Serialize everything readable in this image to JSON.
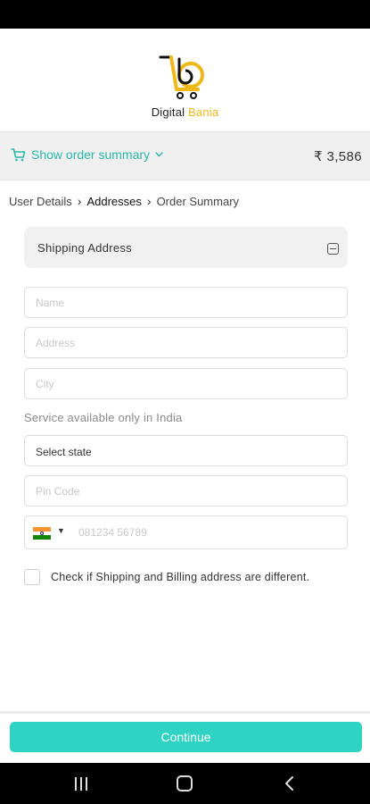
{
  "brand": {
    "logo_word1": "Digital",
    "logo_word2": "Bania",
    "accent_color": "#f1b81a",
    "icon": "digital-bania-logo"
  },
  "order_summary": {
    "toggle_label": "Show order summary",
    "total": "₹ 3,586",
    "icon": "cart-icon",
    "color": "#2ab7aa"
  },
  "breadcrumb": {
    "steps": [
      "User Details",
      "Addresses",
      "Order Summary"
    ],
    "active_step": "Addresses"
  },
  "shipping": {
    "title": "Shipping Address",
    "collapse_icon": "collapse-icon",
    "fields": {
      "name_placeholder": "Name",
      "address_placeholder": "Address",
      "city_placeholder": "City",
      "service_note": "Service available only in India",
      "state_value": "Select state",
      "pincode_placeholder": "Pin Code",
      "phone_placeholder": "081234 56789",
      "country_flag": "india-flag-icon"
    },
    "billing_checkbox_label": "Check if Shipping and Billing address are different.",
    "billing_checked": false
  },
  "actions": {
    "continue_label": "Continue",
    "button_color": "#2ed3c3"
  }
}
